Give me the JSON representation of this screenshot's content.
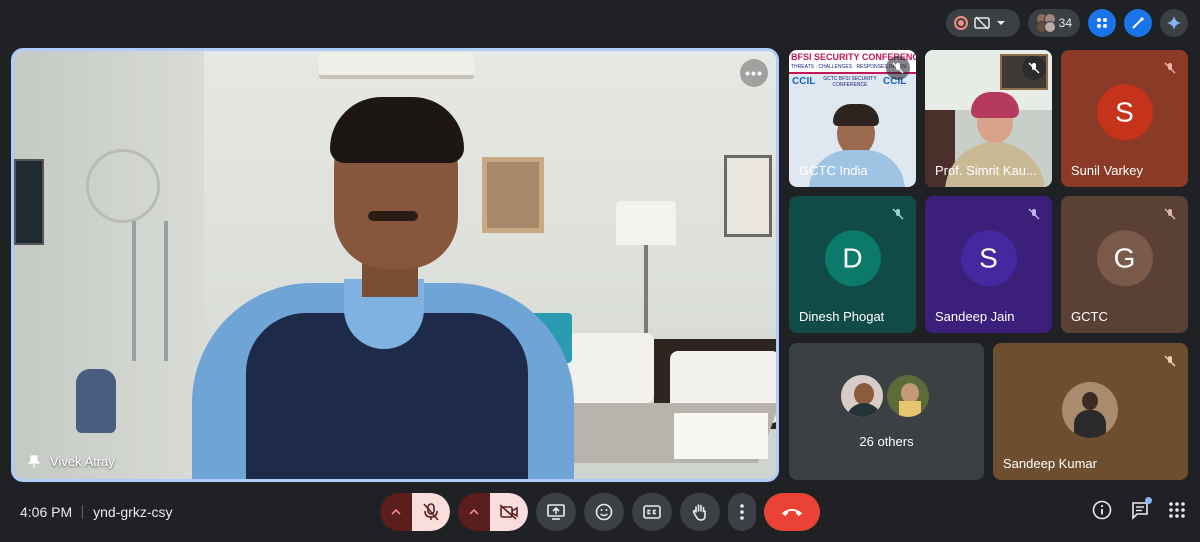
{
  "top_bar": {
    "participant_count": "34"
  },
  "main_speaker": {
    "name": "Vivek Atray"
  },
  "tiles": [
    {
      "name": "GCTC India"
    },
    {
      "name": "Prof. Simrit Kau..."
    },
    {
      "name": "Sunil Varkey",
      "avatar_letter": "S",
      "avatar_color": "#c5341a",
      "bg_color": "#8a3a26"
    },
    {
      "name": "Dinesh Phogat",
      "avatar_letter": "D",
      "avatar_color": "#0b7a6b",
      "bg_color": "#114b47"
    },
    {
      "name": "Sandeep Jain",
      "avatar_letter": "S",
      "avatar_color": "#4527a0",
      "bg_color": "#3b1f7a"
    },
    {
      "name": "GCTC",
      "avatar_letter": "G",
      "avatar_color": "#7b5a4a",
      "bg_color": "#5b4036"
    },
    {
      "name": "26 others"
    },
    {
      "name": "Sandeep Kumar"
    }
  ],
  "slide_text": {
    "banner": "BFSI SECURITY CONFERENCE",
    "sub": "THREATS · CHALLENGES · RESPONSES IN BFSI",
    "logo": "CCIL",
    "badge": "GCTC BFSI SECURITY CONFERENCE"
  },
  "bottom_bar": {
    "time": "4:06 PM",
    "meeting_code": "ynd-grkz-csy"
  },
  "colors": {
    "accent_border": "#aecbfa",
    "end_call": "#ea4335",
    "muted": "#f28b82",
    "background": "#202124"
  }
}
